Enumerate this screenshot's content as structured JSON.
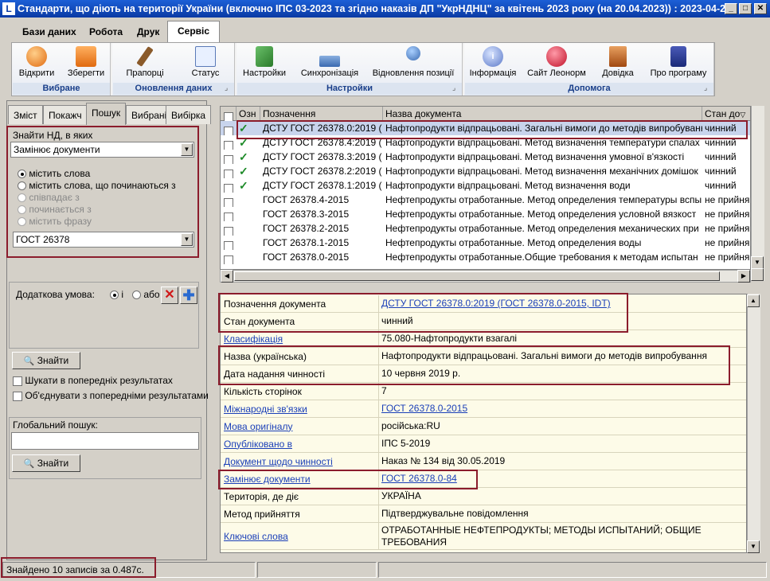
{
  "window": {
    "title": "Стандарти, що діють на території України (включно ІПС 03-2023 та згідно наказів ДП \"УкрНДНЦ\"  за квітень 2023 року (на 20.04.2023)) : 2023-04-2...",
    "logo": "L",
    "minimize": "_",
    "maximize": "□",
    "close": "✕"
  },
  "menu": {
    "tabs": [
      {
        "label": "Бази даних"
      },
      {
        "label": "Робота"
      },
      {
        "label": "Друк"
      },
      {
        "label": "Сервіс"
      }
    ]
  },
  "ribbon": {
    "groups": [
      {
        "caption": "Вибране",
        "buttons": [
          {
            "label": "Відкрити",
            "icon": "open-icon"
          },
          {
            "label": "Зберегти",
            "icon": "save-icon"
          }
        ]
      },
      {
        "caption": "Оновлення даних",
        "buttons": [
          {
            "label": "Прапорці",
            "icon": "flags-icon"
          },
          {
            "label": "Статус",
            "icon": "status-icon"
          }
        ]
      },
      {
        "caption": "Настройки",
        "buttons": [
          {
            "label": "Настройки",
            "icon": "settings-icon"
          },
          {
            "label": "Синхронізація",
            "icon": "sync-icon"
          },
          {
            "label": "Відновлення позиції",
            "icon": "pin-icon"
          }
        ]
      },
      {
        "caption": "Допомога",
        "buttons": [
          {
            "label": "Інформація",
            "icon": "info-icon"
          },
          {
            "label": "Сайт Леонорм",
            "icon": "site-icon"
          },
          {
            "label": "Довідка",
            "icon": "help-icon"
          },
          {
            "label": "Про програму",
            "icon": "about-icon"
          }
        ]
      }
    ],
    "expander": "⌟"
  },
  "left": {
    "tabs": [
      {
        "label": "Зміст"
      },
      {
        "label": "Покажч"
      },
      {
        "label": "Пошук"
      },
      {
        "label": "Вибрані"
      },
      {
        "label": "Вибірка"
      }
    ],
    "find_label": "Знайти НД, в яких",
    "find_select": "Замінює документи",
    "radios": [
      {
        "label": "містить слова",
        "checked": true,
        "enabled": true
      },
      {
        "label": "містить слова, що починаються з",
        "checked": false,
        "enabled": true
      },
      {
        "label": "співпадає з",
        "checked": false,
        "enabled": false
      },
      {
        "label": "починається з",
        "checked": false,
        "enabled": false
      },
      {
        "label": "містить фразу",
        "checked": false,
        "enabled": false
      }
    ],
    "query_select": "ГОСТ 26378",
    "extra_label": "Додаткова умова:",
    "extra_and": "і",
    "extra_or": "або",
    "find_button": "Знайти",
    "chk_prev": "Шукати в попередніх результатах",
    "chk_merge": "Об'єднувати з попередніми результатами",
    "global_label": "Глобальний пошук:",
    "global_value": "",
    "global_button": "Знайти"
  },
  "grid": {
    "headers": {
      "ozn": "Озн",
      "code": "Позначення",
      "name": "Назва документа",
      "status": "Стан до"
    },
    "rows": [
      {
        "tick": "✓",
        "code": "ДСТУ ГОСТ 26378.0:2019 (",
        "name": "Нафтопродукти відпрацьовані. Загальні вимоги до методів випробування",
        "status": "чинний"
      },
      {
        "tick": "✓",
        "code": "ДСТУ ГОСТ 26378.4:2019 (",
        "name": "Нафтопродукти відпрацьовані. Метод визначення температури спалах",
        "status": "чинний"
      },
      {
        "tick": "✓",
        "code": "ДСТУ ГОСТ 26378.3:2019 (",
        "name": "Нафтопродукти відпрацьовані. Метод визначення умовної в'язкості",
        "status": "чинний"
      },
      {
        "tick": "✓",
        "code": "ДСТУ ГОСТ 26378.2:2019 (",
        "name": "Нафтопродукти відпрацьовані. Метод визначення механічних домішок",
        "status": "чинний"
      },
      {
        "tick": "✓",
        "code": "ДСТУ ГОСТ 26378.1:2019 (",
        "name": "Нафтопродукти відпрацьовані. Метод визначення води",
        "status": "чинний"
      },
      {
        "tick": "",
        "code": "ГОСТ 26378.4-2015",
        "name": "Нефтепродукты отработанные. Метод определения температуры вспы",
        "status": "не прийня"
      },
      {
        "tick": "",
        "code": "ГОСТ 26378.3-2015",
        "name": "Нефтепродукты отработанные. Метод определения условной вязкост",
        "status": "не прийня"
      },
      {
        "tick": "",
        "code": "ГОСТ 26378.2-2015",
        "name": "Нефтепродукты отработанные. Метод определения механических при",
        "status": "не прийня"
      },
      {
        "tick": "",
        "code": "ГОСТ 26378.1-2015",
        "name": "Нефтепродукты отработанные. Метод определения воды",
        "status": "не прийня"
      },
      {
        "tick": "",
        "code": "ГОСТ 26378.0-2015",
        "name": "Нефтепродукты отработанные.Общие требования к методам испытан",
        "status": "не прийня"
      }
    ]
  },
  "details": {
    "rows": [
      {
        "key": "Позначення документа",
        "value": "ДСТУ ГОСТ 26378.0:2019 (ГОСТ 26378.0-2015, IDT)",
        "key_link": false,
        "value_link": true
      },
      {
        "key": "Стан документа",
        "value": "чинний",
        "key_link": false,
        "value_link": false
      },
      {
        "key": "Класифікація",
        "value": "75.080-Нафтопродукти взагалі",
        "key_link": true,
        "value_link": false
      },
      {
        "key": "Назва (українська)",
        "value": "Нафтопродукти відпрацьовані. Загальні вимоги до методів випробування",
        "key_link": false,
        "value_link": false
      },
      {
        "key": "Дата надання чинності",
        "value": "10 червня 2019 р.",
        "key_link": false,
        "value_link": false
      },
      {
        "key": "Кількість сторінок",
        "value": "7",
        "key_link": false,
        "value_link": false
      },
      {
        "key": "Міжнародні зв'язки",
        "value": "ГОСТ 26378.0-2015",
        "key_link": true,
        "value_link": true
      },
      {
        "key": "Мова оригіналу",
        "value": "російська:RU",
        "key_link": true,
        "value_link": false
      },
      {
        "key": "Опубліковано в",
        "value": "ІПС 5-2019",
        "key_link": true,
        "value_link": false
      },
      {
        "key": "Документ щодо чинності",
        "value": "Наказ № 134 від 30.05.2019",
        "key_link": true,
        "value_link": false
      },
      {
        "key": "Замінює документи",
        "value": "ГОСТ 26378.0-84",
        "key_link": true,
        "value_link": true
      },
      {
        "key": "Територія, де діє",
        "value": "УКРАЇНА",
        "key_link": false,
        "value_link": false
      },
      {
        "key": "Метод прийняття",
        "value": "Підтверджувальне повідомлення",
        "key_link": false,
        "value_link": false
      },
      {
        "key": "Ключові слова",
        "value": "ОТРАБОТАННЫЕ НЕФТЕПРОДУКТЫ; МЕТОДЫ ИСПЫТАНИЙ; ОБЩИЕ ТРЕБОВАНИЯ",
        "key_link": true,
        "value_link": false
      }
    ]
  },
  "status": {
    "text": "Знайдено 10 записів за 0.487с."
  },
  "colors": {
    "highlight": "#8b1c2c",
    "link": "#1a3fb8",
    "selected_row": "#c8d4ec",
    "details_bg": "#fdfbe8"
  }
}
